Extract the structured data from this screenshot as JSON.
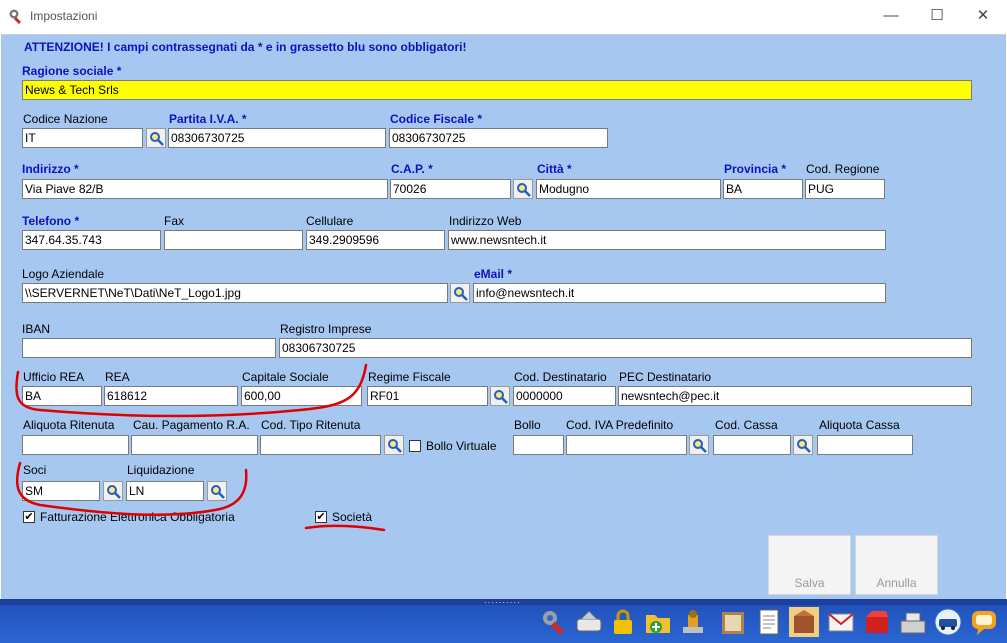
{
  "window": {
    "title": "Impostazioni"
  },
  "warning": "ATTENZIONE! I campi contrassegnati da * e in grassetto blu sono obbligatori!",
  "labels": {
    "ragione_sociale": "Ragione sociale *",
    "codice_nazione": "Codice Nazione",
    "partita_iva": "Partita I.V.A. *",
    "codice_fiscale": "Codice Fiscale *",
    "indirizzo": "Indirizzo *",
    "cap": "C.A.P. *",
    "citta": "Città *",
    "provincia": "Provincia *",
    "cod_regione": "Cod. Regione",
    "telefono": "Telefono *",
    "fax": "Fax",
    "cellulare": "Cellulare",
    "indirizzo_web": "Indirizzo Web",
    "logo": "Logo Aziendale",
    "email": "eMail *",
    "iban": "IBAN",
    "registro_imprese": "Registro Imprese",
    "ufficio_rea": "Ufficio REA",
    "rea": "REA",
    "capitale_sociale": "Capitale Sociale",
    "regime_fiscale": "Regime Fiscale",
    "cod_destinatario": "Cod. Destinatario",
    "pec_destinatario": "PEC Destinatario",
    "aliquota_ritenuta": "Aliquota Ritenuta",
    "cau_pagamento": "Cau. Pagamento R.A.",
    "cod_tipo_ritenuta": "Cod. Tipo Ritenuta",
    "bollo_virtuale": "Bollo Virtuale",
    "bollo": "Bollo",
    "cod_iva": "Cod. IVA Predefinito",
    "cod_cassa": "Cod. Cassa",
    "aliquota_cassa": "Aliquota Cassa",
    "soci": "Soci",
    "liquidazione": "Liquidazione",
    "fatturazione": "Fatturazione Elettronica Obbligatoria",
    "societa": "Società"
  },
  "values": {
    "ragione_sociale": "News & Tech Srls",
    "codice_nazione": "IT",
    "partita_iva": "08306730725",
    "codice_fiscale": "08306730725",
    "indirizzo": "Via Piave 82/B",
    "cap": "70026",
    "citta": "Modugno",
    "provincia": "BA",
    "cod_regione": "PUG",
    "telefono": "347.64.35.743",
    "fax": "",
    "cellulare": "349.2909596",
    "indirizzo_web": "www.newsntech.it",
    "logo": "\\\\SERVERNET\\NeT\\Dati\\NeT_Logo1.jpg",
    "email": "info@newsntech.it",
    "iban": "",
    "registro_imprese": "08306730725",
    "ufficio_rea": "BA",
    "rea": "618612",
    "capitale_sociale": "600,00",
    "regime_fiscale": "RF01",
    "cod_destinatario": "0000000",
    "pec_destinatario": "newsntech@pec.it",
    "aliquota_ritenuta": "",
    "cau_pagamento": "",
    "cod_tipo_ritenuta": "",
    "bollo": "",
    "cod_iva": "",
    "cod_cassa": "",
    "aliquota_cassa": "",
    "soci": "SM",
    "liquidazione": "LN"
  },
  "checks": {
    "bollo_virtuale": false,
    "fatturazione": true,
    "societa": true
  },
  "buttons": {
    "salva": "Salva",
    "annulla": "Annulla"
  },
  "toolbar_icons": [
    "tools-icon",
    "scanner-icon",
    "lock-icon",
    "folder-add-icon",
    "stamp-icon",
    "book-icon",
    "document-icon",
    "box-icon",
    "email-icon",
    "red-box-icon",
    "cash-register-icon",
    "car-icon",
    "chat-icon"
  ],
  "colors": {
    "form_background": "#a6c8f0",
    "required_label": "#1010c0",
    "highlight_field": "#ffff00",
    "toolbar": "#2b66d2",
    "annotation": "#e00000"
  }
}
